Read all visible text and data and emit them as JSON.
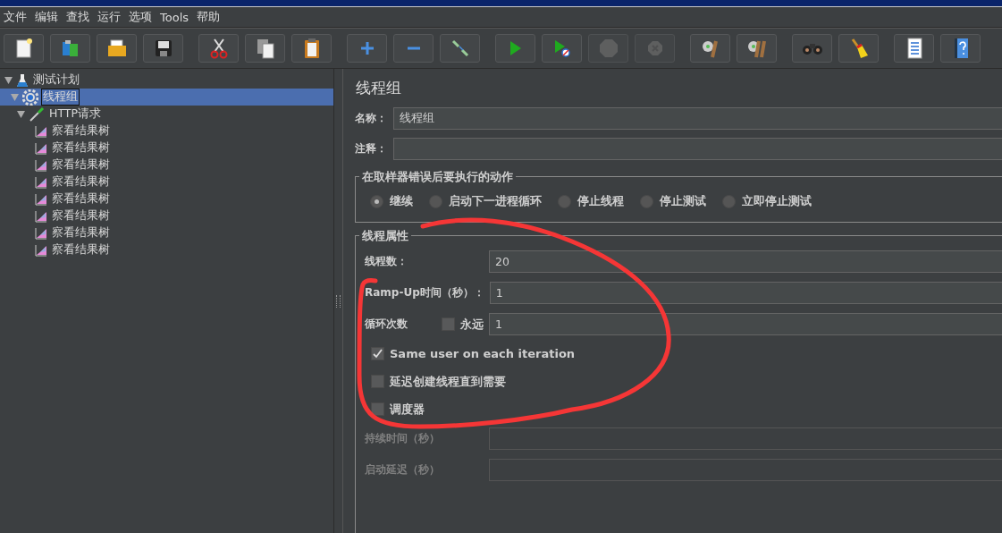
{
  "menu": [
    "文件",
    "编辑",
    "查找",
    "运行",
    "选项",
    "Tools",
    "帮助"
  ],
  "toolbar": [
    [
      {
        "kind": "new",
        "disabled": false
      },
      {
        "kind": "templates",
        "disabled": false
      },
      {
        "kind": "open",
        "disabled": false
      },
      {
        "kind": "save",
        "disabled": false
      }
    ],
    [
      {
        "kind": "cut",
        "disabled": false
      },
      {
        "kind": "copy",
        "disabled": false
      },
      {
        "kind": "paste",
        "disabled": false
      }
    ],
    [
      {
        "kind": "expand",
        "disabled": false
      },
      {
        "kind": "collapse",
        "disabled": false
      },
      {
        "kind": "toggle",
        "disabled": false
      }
    ],
    [
      {
        "kind": "start",
        "disabled": false
      },
      {
        "kind": "start-no-timers",
        "disabled": false
      },
      {
        "kind": "stop",
        "disabled": true
      },
      {
        "kind": "shutdown",
        "disabled": true
      }
    ],
    [
      {
        "kind": "clear",
        "disabled": false
      },
      {
        "kind": "clear-all",
        "disabled": false
      }
    ],
    [
      {
        "kind": "search",
        "disabled": false
      },
      {
        "kind": "reset-search",
        "disabled": false
      }
    ],
    [
      {
        "kind": "function-helper",
        "disabled": false
      },
      {
        "kind": "help",
        "disabled": false
      }
    ]
  ],
  "tree": [
    {
      "label": "测试计划",
      "kind": "plan",
      "expanded": true,
      "selected": false,
      "children": [
        {
          "label": "线程组",
          "kind": "thread-group",
          "expanded": true,
          "selected": true,
          "children": [
            {
              "label": "HTTP请求",
              "kind": "sampler",
              "expanded": true,
              "selected": false,
              "children": [
                {
                  "label": "察看结果树",
                  "kind": "listener",
                  "selected": false
                },
                {
                  "label": "察看结果树",
                  "kind": "listener",
                  "selected": false
                },
                {
                  "label": "察看结果树",
                  "kind": "listener",
                  "selected": false
                },
                {
                  "label": "察看结果树",
                  "kind": "listener",
                  "selected": false
                },
                {
                  "label": "察看结果树",
                  "kind": "listener",
                  "selected": false
                },
                {
                  "label": "察看结果树",
                  "kind": "listener",
                  "selected": false
                },
                {
                  "label": "察看结果树",
                  "kind": "listener",
                  "selected": false
                },
                {
                  "label": "察看结果树",
                  "kind": "listener",
                  "selected": false
                }
              ]
            }
          ]
        }
      ]
    }
  ],
  "panel": {
    "title": "线程组",
    "fields": [
      {
        "label": "名称：",
        "value": "线程组"
      },
      {
        "label": "注释："
      }
    ],
    "error_action": {
      "title": "在取样器错误后要执行的动作",
      "options": [
        {
          "label": "继续",
          "selected": true
        },
        {
          "label": "启动下一进程循环",
          "selected": false
        },
        {
          "label": "停止线程",
          "selected": false
        },
        {
          "label": "停止测试",
          "selected": false
        },
        {
          "label": "立即停止测试",
          "selected": false
        }
      ]
    },
    "thread_properties": {
      "title": "线程属性",
      "rows": [
        {
          "kind": "field",
          "label": "线程数：",
          "value": "20",
          "disabled": false
        },
        {
          "kind": "field",
          "label": "Ramp-Up时间（秒）：",
          "value": "1",
          "disabled": false
        },
        {
          "kind": "loop",
          "label": "循环次数",
          "checkbox": {
            "label": "永远",
            "checked": false
          },
          "value": "1",
          "disabled": false
        },
        {
          "kind": "check",
          "label": "Same user on each iteration",
          "checked": true
        },
        {
          "kind": "check",
          "label": "延迟创建线程直到需要",
          "checked": false
        },
        {
          "kind": "check",
          "label": "调度器",
          "checked": false
        },
        {
          "kind": "field",
          "label": "持续时间（秒）",
          "disabled": true
        },
        {
          "kind": "field",
          "label": "启动延迟（秒）",
          "disabled": true
        }
      ]
    }
  }
}
